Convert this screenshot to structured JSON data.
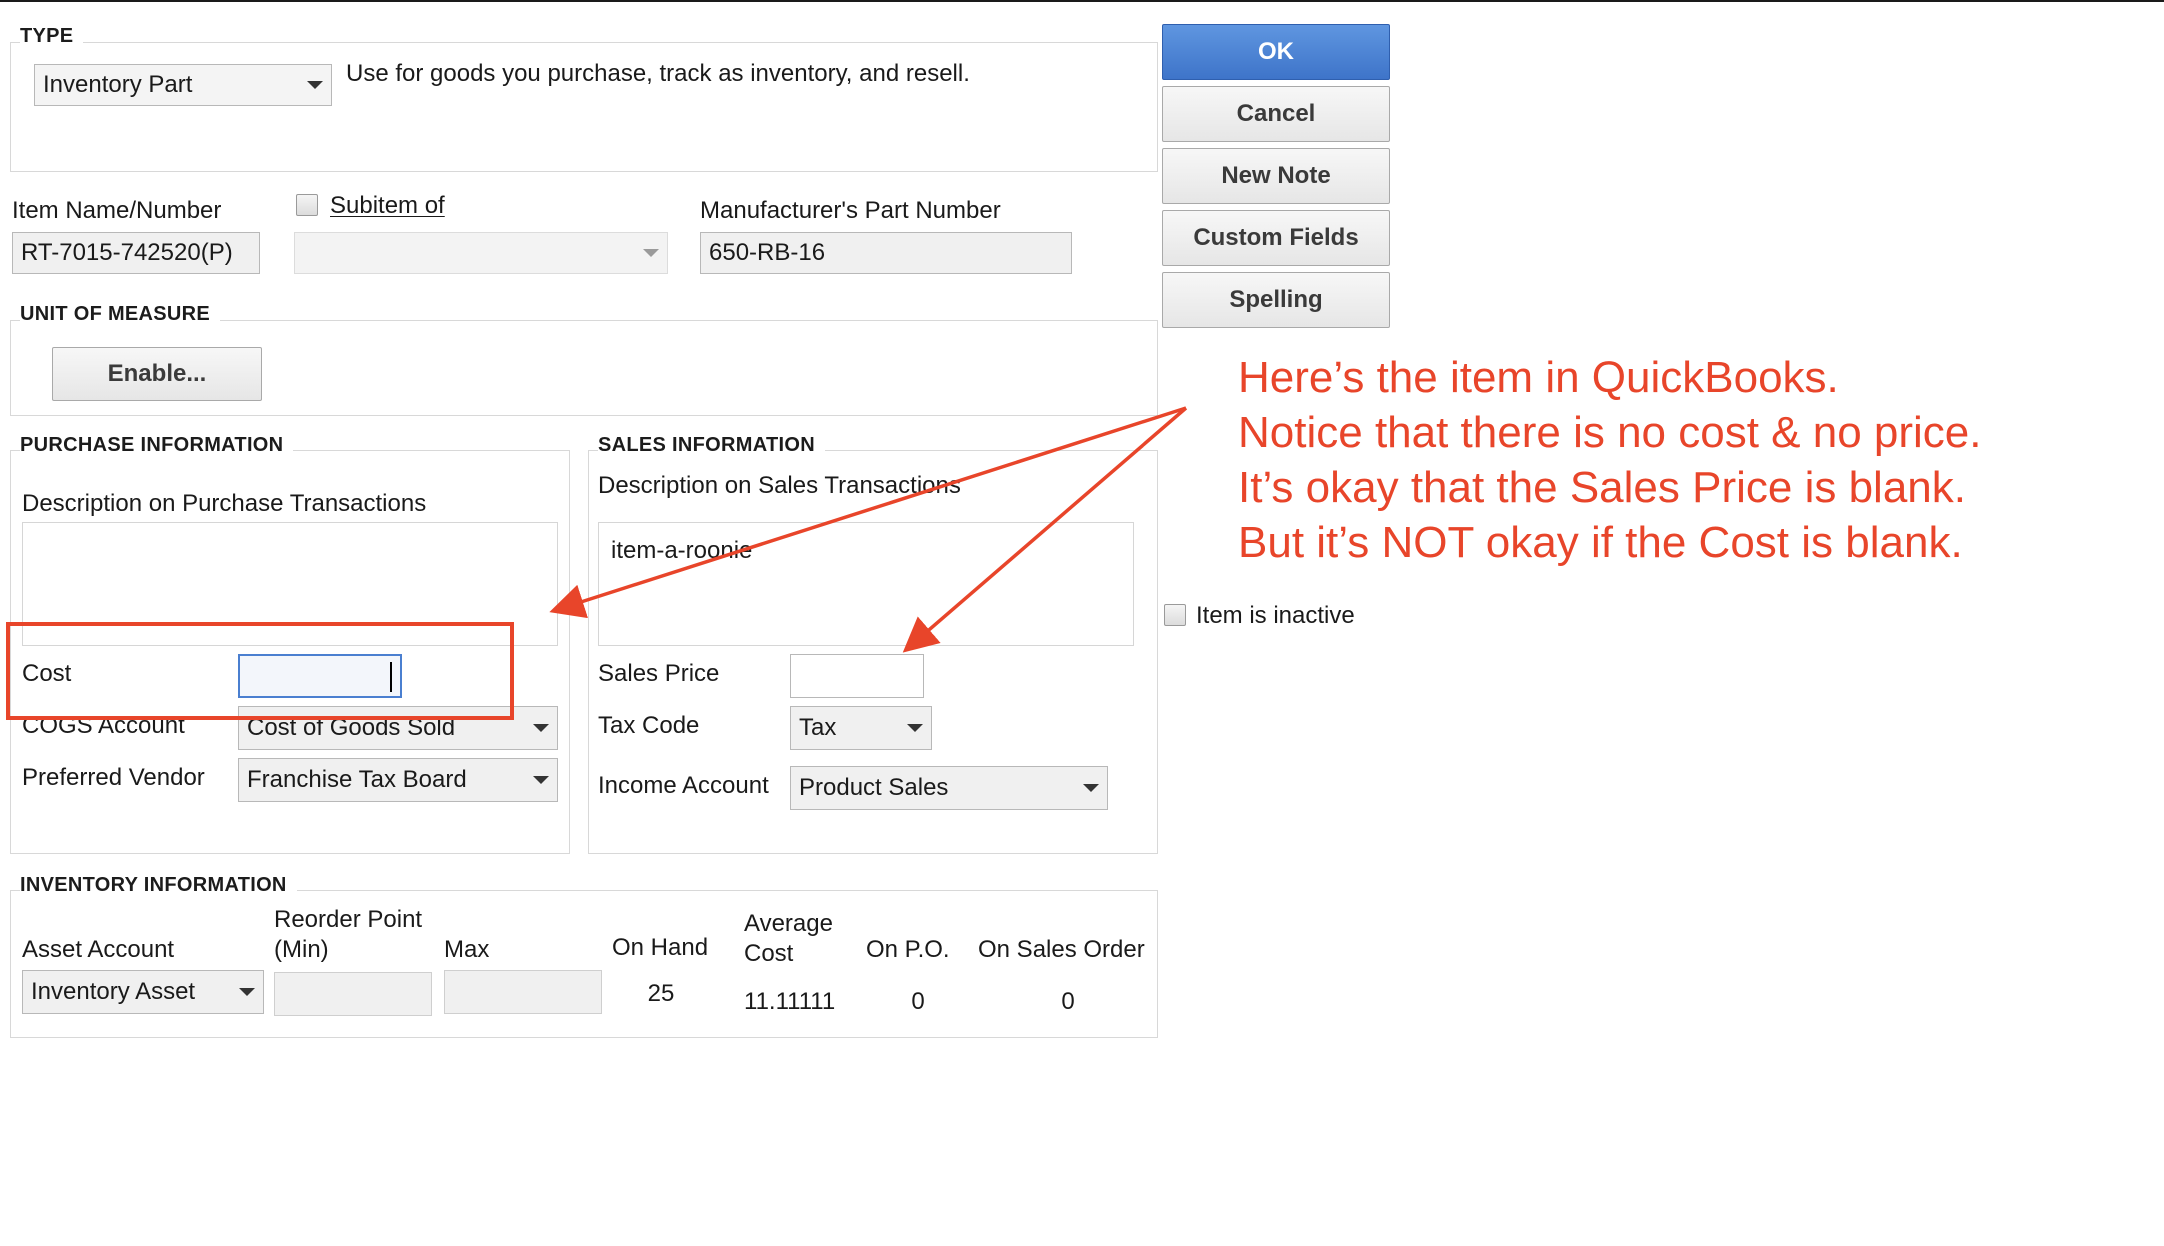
{
  "type_section": {
    "title": "TYPE",
    "type_value": "Inventory Part",
    "description": "Use for goods you purchase, track as inventory, and resell."
  },
  "item": {
    "name_label": "Item Name/Number",
    "name_value": "RT-7015-742520(P)",
    "subitem_label": "Subitem of",
    "subitem_value": "",
    "mpn_label": "Manufacturer's Part Number",
    "mpn_value": "650-RB-16"
  },
  "unit_of_measure": {
    "title": "UNIT OF MEASURE",
    "enable_label": "Enable..."
  },
  "purchase": {
    "title": "PURCHASE INFORMATION",
    "desc_label": "Description on Purchase Transactions",
    "desc_value": "",
    "cost_label": "Cost",
    "cost_value": "",
    "cogs_label": "COGS Account",
    "cogs_value": "Cost of Goods Sold",
    "vendor_label": "Preferred Vendor",
    "vendor_value": "Franchise Tax Board"
  },
  "sales": {
    "title": "SALES INFORMATION",
    "desc_label": "Description on Sales Transactions",
    "desc_value": "item-a-roonie",
    "price_label": "Sales Price",
    "price_value": "",
    "tax_label": "Tax Code",
    "tax_value": "Tax",
    "income_label": "Income Account",
    "income_value": "Product Sales"
  },
  "inventory": {
    "title": "INVENTORY INFORMATION",
    "asset_label": "Asset Account",
    "asset_value": "Inventory Asset",
    "reorder_label_1": "Reorder Point",
    "reorder_label_2": "(Min)",
    "reorder_value": "",
    "max_label": "Max",
    "max_value": "",
    "on_hand_label": "On Hand",
    "on_hand_value": "25",
    "avg_cost_label_1": "Average",
    "avg_cost_label_2": "Cost",
    "avg_cost_value": "11.11111",
    "on_po_label": "On P.O.",
    "on_po_value": "0",
    "on_so_label": "On Sales Order",
    "on_so_value": "0"
  },
  "buttons": {
    "ok": "OK",
    "cancel": "Cancel",
    "new_note": "New Note",
    "custom_fields": "Custom Fields",
    "spelling": "Spelling"
  },
  "inactive_label": "Item is inactive",
  "annotation": {
    "line1": "Here’s the item in QuickBooks.",
    "line2": "Notice that there is no cost & no price.",
    "line3": "It’s okay that the Sales Price is blank.",
    "line4": "But it’s NOT okay if the Cost is blank.",
    "color": "#e8452a"
  },
  "colors": {
    "primary_button": "#4a80d4",
    "highlight_box": "#e8452a",
    "focus_field": "#4a7fd0"
  }
}
